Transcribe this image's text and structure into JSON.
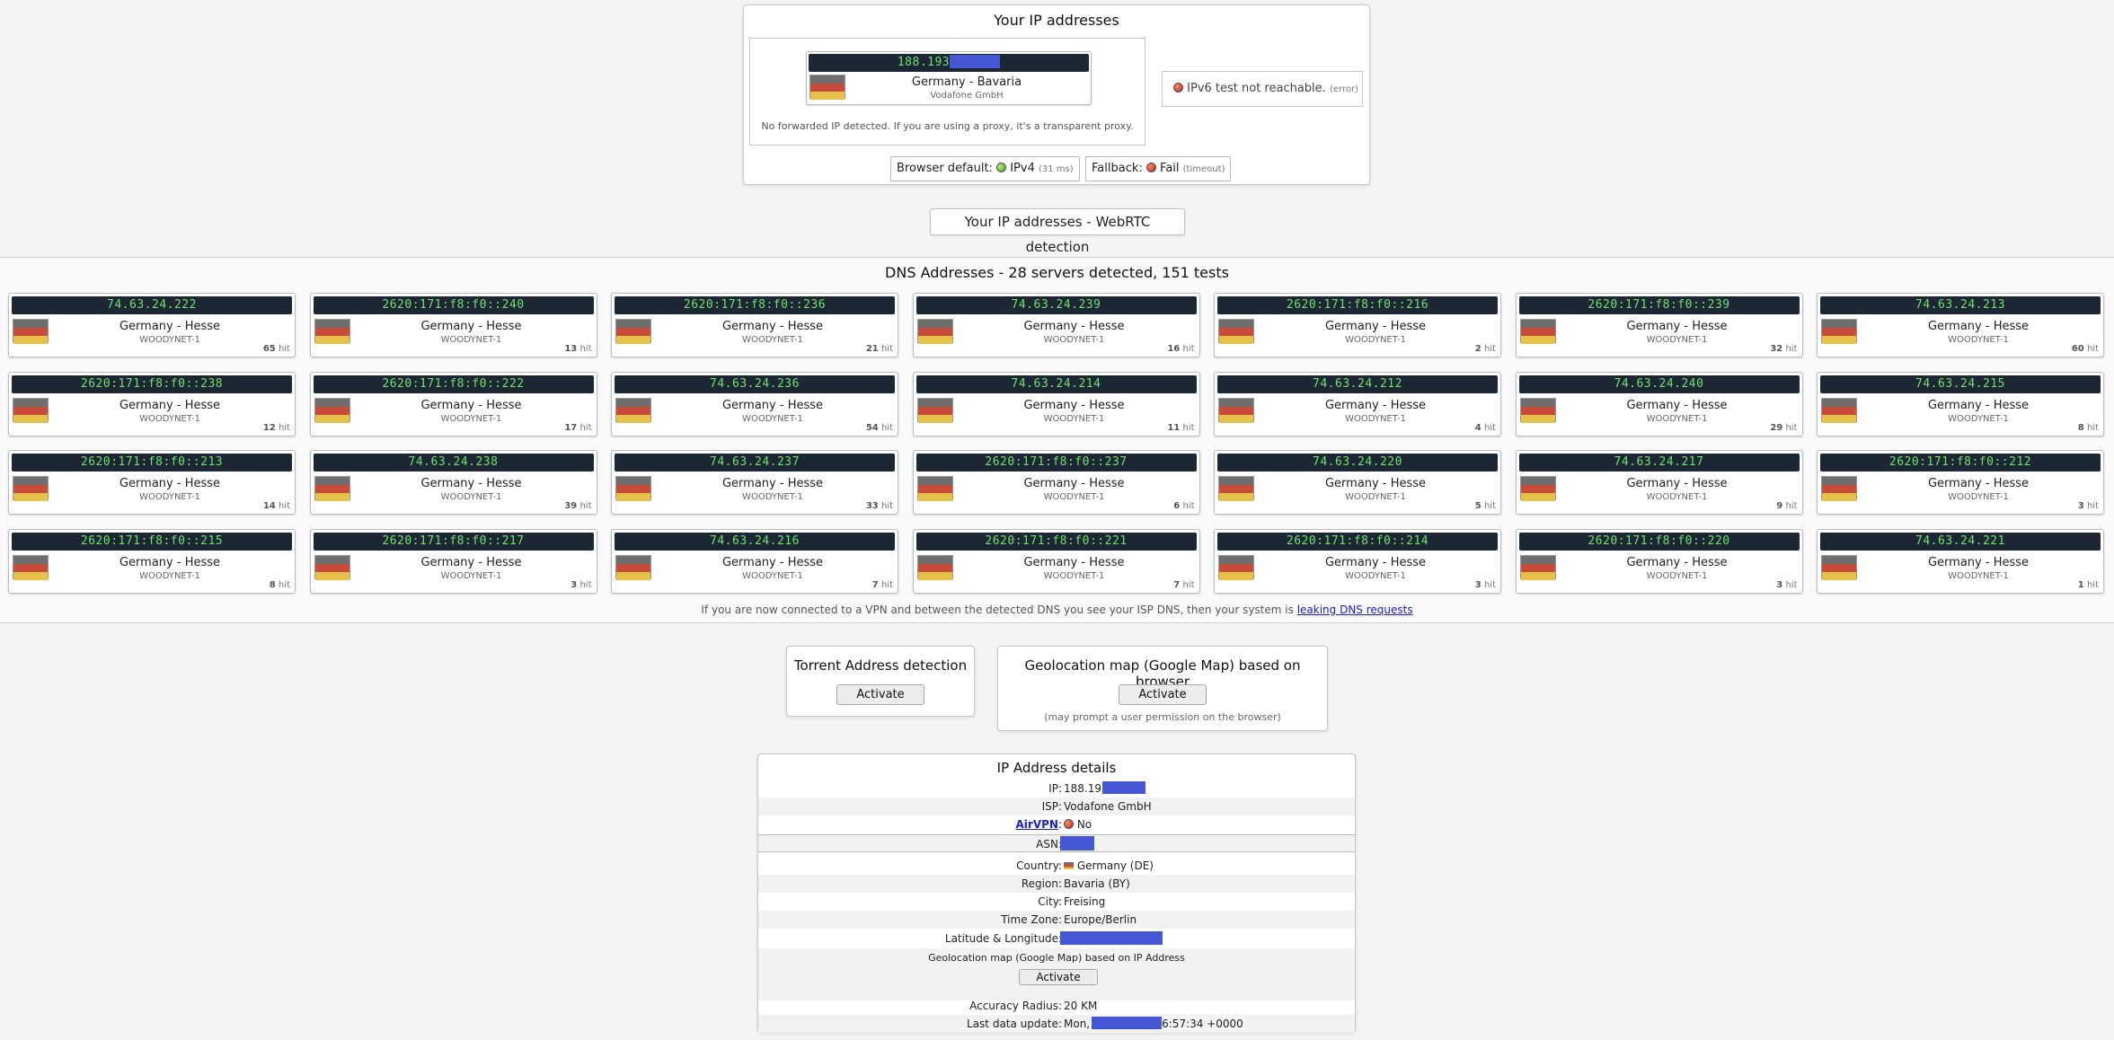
{
  "ip_panel": {
    "title": "Your IP addresses",
    "ip_prefix": "188.193",
    "location": "Germany - Bavaria",
    "isp": "Vodafone GmbH",
    "no_forwarded": "No forwarded IP detected. If you are using a proxy, it's a transparent proxy.",
    "ipv6_text": "IPv6 test not reachable.",
    "ipv6_note": "(error)",
    "browser_default_label": "Browser default:",
    "browser_default_value": "IPv4",
    "browser_default_note": "(31 ms)",
    "fallback_label": "Fallback:",
    "fallback_value": "Fail",
    "fallback_note": "(timeout)"
  },
  "webrtc_button": "Your IP addresses - WebRTC detection",
  "dns": {
    "title": "DNS Addresses - 28 servers detected, 151 tests",
    "location": "Germany - Hesse",
    "isp": "WOODYNET-1",
    "hit_label": "hit",
    "servers": [
      {
        "ip": "74.63.24.222",
        "hits": "65"
      },
      {
        "ip": "2620:171:f8:f0::240",
        "hits": "13"
      },
      {
        "ip": "2620:171:f8:f0::236",
        "hits": "21"
      },
      {
        "ip": "74.63.24.239",
        "hits": "16"
      },
      {
        "ip": "2620:171:f8:f0::216",
        "hits": "2"
      },
      {
        "ip": "2620:171:f8:f0::239",
        "hits": "32"
      },
      {
        "ip": "74.63.24.213",
        "hits": "60"
      },
      {
        "ip": "2620:171:f8:f0::238",
        "hits": "12"
      },
      {
        "ip": "2620:171:f8:f0::222",
        "hits": "17"
      },
      {
        "ip": "74.63.24.236",
        "hits": "54"
      },
      {
        "ip": "74.63.24.214",
        "hits": "11"
      },
      {
        "ip": "74.63.24.212",
        "hits": "4"
      },
      {
        "ip": "74.63.24.240",
        "hits": "29"
      },
      {
        "ip": "74.63.24.215",
        "hits": "8"
      },
      {
        "ip": "2620:171:f8:f0::213",
        "hits": "14"
      },
      {
        "ip": "74.63.24.238",
        "hits": "39"
      },
      {
        "ip": "74.63.24.237",
        "hits": "33"
      },
      {
        "ip": "2620:171:f8:f0::237",
        "hits": "6"
      },
      {
        "ip": "74.63.24.220",
        "hits": "5"
      },
      {
        "ip": "74.63.24.217",
        "hits": "9"
      },
      {
        "ip": "2620:171:f8:f0::212",
        "hits": "3"
      },
      {
        "ip": "2620:171:f8:f0::215",
        "hits": "8"
      },
      {
        "ip": "2620:171:f8:f0::217",
        "hits": "3"
      },
      {
        "ip": "74.63.24.216",
        "hits": "7"
      },
      {
        "ip": "2620:171:f8:f0::221",
        "hits": "7"
      },
      {
        "ip": "2620:171:f8:f0::214",
        "hits": "3"
      },
      {
        "ip": "2620:171:f8:f0::220",
        "hits": "3"
      },
      {
        "ip": "74.63.24.221",
        "hits": "1"
      }
    ],
    "leak_text": "If you are now connected to a VPN and between the detected DNS you see your ISP DNS, then your system is",
    "leak_link": "leaking DNS requests"
  },
  "torrent": {
    "title": "Torrent Address detection",
    "button": "Activate"
  },
  "geomap": {
    "title": "Geolocation map (Google Map) based on browser",
    "button": "Activate",
    "note": "(may prompt a user permission on the browser)"
  },
  "details": {
    "title": "IP Address details",
    "ip_label": "IP:",
    "ip_value": "188.193",
    "isp_label": "ISP:",
    "isp_value": "Vodafone GmbH",
    "airvpn_label": "AirVPN",
    "airvpn_value": "No",
    "asn_label": "ASN:",
    "country_label": "Country:",
    "country_value": "Germany (DE)",
    "region_label": "Region:",
    "region_value": "Bavaria (BY)",
    "city_label": "City:",
    "city_value": "Freising",
    "timezone_label": "Time Zone:",
    "timezone_value": "Europe/Berlin",
    "latlon_label": "Latitude & Longitude:",
    "geomap_text": "Geolocation map (Google Map) based on IP Address",
    "geomap_button": "Activate",
    "accuracy_label": "Accuracy Radius:",
    "accuracy_value": "20 KM",
    "lastupdate_label": "Last data update:",
    "lastupdate_prefix": "Mon,",
    "lastupdate_suffix": "6:57:34 +0000"
  },
  "colors": {
    "ip_bar_bg": "#1c2733",
    "ip_bar_text": "#6fe06f",
    "redaction": "#4657d6",
    "link": "#1a20c8"
  }
}
